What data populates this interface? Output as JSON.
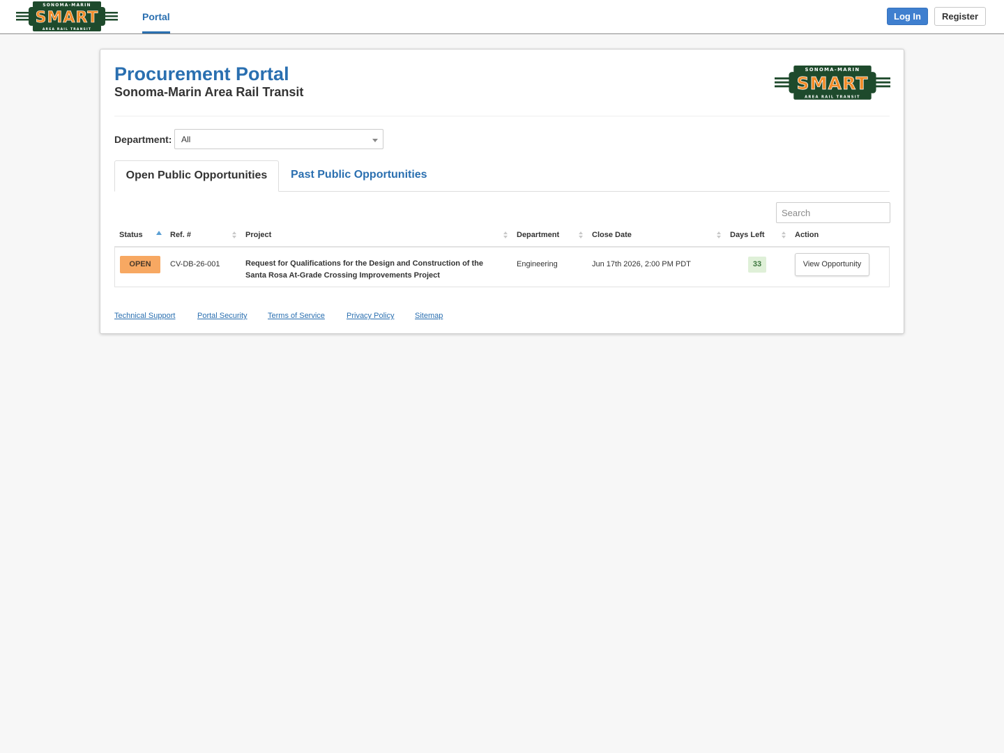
{
  "brand": {
    "logo_top": "SONOMA-MARIN",
    "logo_main": "SMART",
    "logo_bottom": "AREA RAIL TRANSIT",
    "colors": {
      "green": "#1e4a2c",
      "orange": "#f28c28",
      "primary": "#2a6fb0"
    }
  },
  "nav": {
    "tab": "Portal",
    "login_label": "Log In",
    "register_label": "Register"
  },
  "header": {
    "title": "Procurement Portal",
    "subtitle": "Sonoma-Marin Area Rail Transit"
  },
  "filter": {
    "label": "Department:",
    "selected": "All"
  },
  "tabs": [
    {
      "label": "Open Public Opportunities",
      "active": true
    },
    {
      "label": "Past Public Opportunities",
      "active": false
    }
  ],
  "search": {
    "placeholder": "Search"
  },
  "table": {
    "columns": [
      "Status",
      "Ref. #",
      "Project",
      "Department",
      "Close Date",
      "Days Left",
      "Action"
    ],
    "sorted_by": "Status",
    "rows": [
      {
        "status": "OPEN",
        "ref": "CV-DB-26-001",
        "project_line1": "Request for Qualifications for the Design and Construction of the",
        "project_line2": "Santa Rosa At-Grade Crossing Improvements Project",
        "department": "Engineering",
        "close_date": "Jun 17th 2026, 2:00 PM PDT",
        "days_left": "33",
        "action_label": "View Opportunity"
      }
    ]
  },
  "footer": {
    "links": [
      "Technical Support",
      "Portal Security",
      "Terms of Service",
      "Privacy Policy",
      "Sitemap"
    ]
  }
}
